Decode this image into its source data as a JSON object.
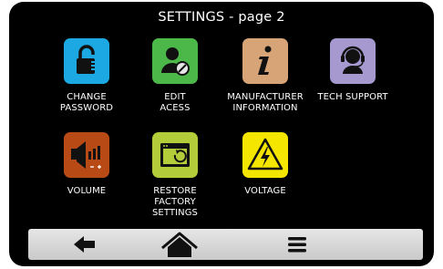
{
  "screen": {
    "title": "SETTINGS - page 2"
  },
  "tiles": [
    {
      "label": "CHANGE\nPASSWORD",
      "icon": "padlock-icon",
      "color": "#1ca8e3"
    },
    {
      "label": "EDIT\nACESS",
      "icon": "user-edit-icon",
      "color": "#4cb84a"
    },
    {
      "label": "MANUFACTURER\nINFORMATION",
      "icon": "info-icon",
      "color": "#d7a477"
    },
    {
      "label": "TECH SUPPORT",
      "icon": "headset-icon",
      "color": "#a599cf"
    },
    {
      "label": "VOLUME",
      "icon": "speaker-icon",
      "color": "#b84a16"
    },
    {
      "label": "RESTORE\nFACTORY\nSETTINGS",
      "icon": "restore-icon",
      "color": "#b3cc3a"
    },
    {
      "label": "VOLTAGE",
      "icon": "high-voltage-icon",
      "color": "#f5e600"
    }
  ],
  "nav": {
    "back_icon": "arrow-left-icon",
    "home_icon": "home-icon",
    "menu_icon": "menu-icon"
  }
}
